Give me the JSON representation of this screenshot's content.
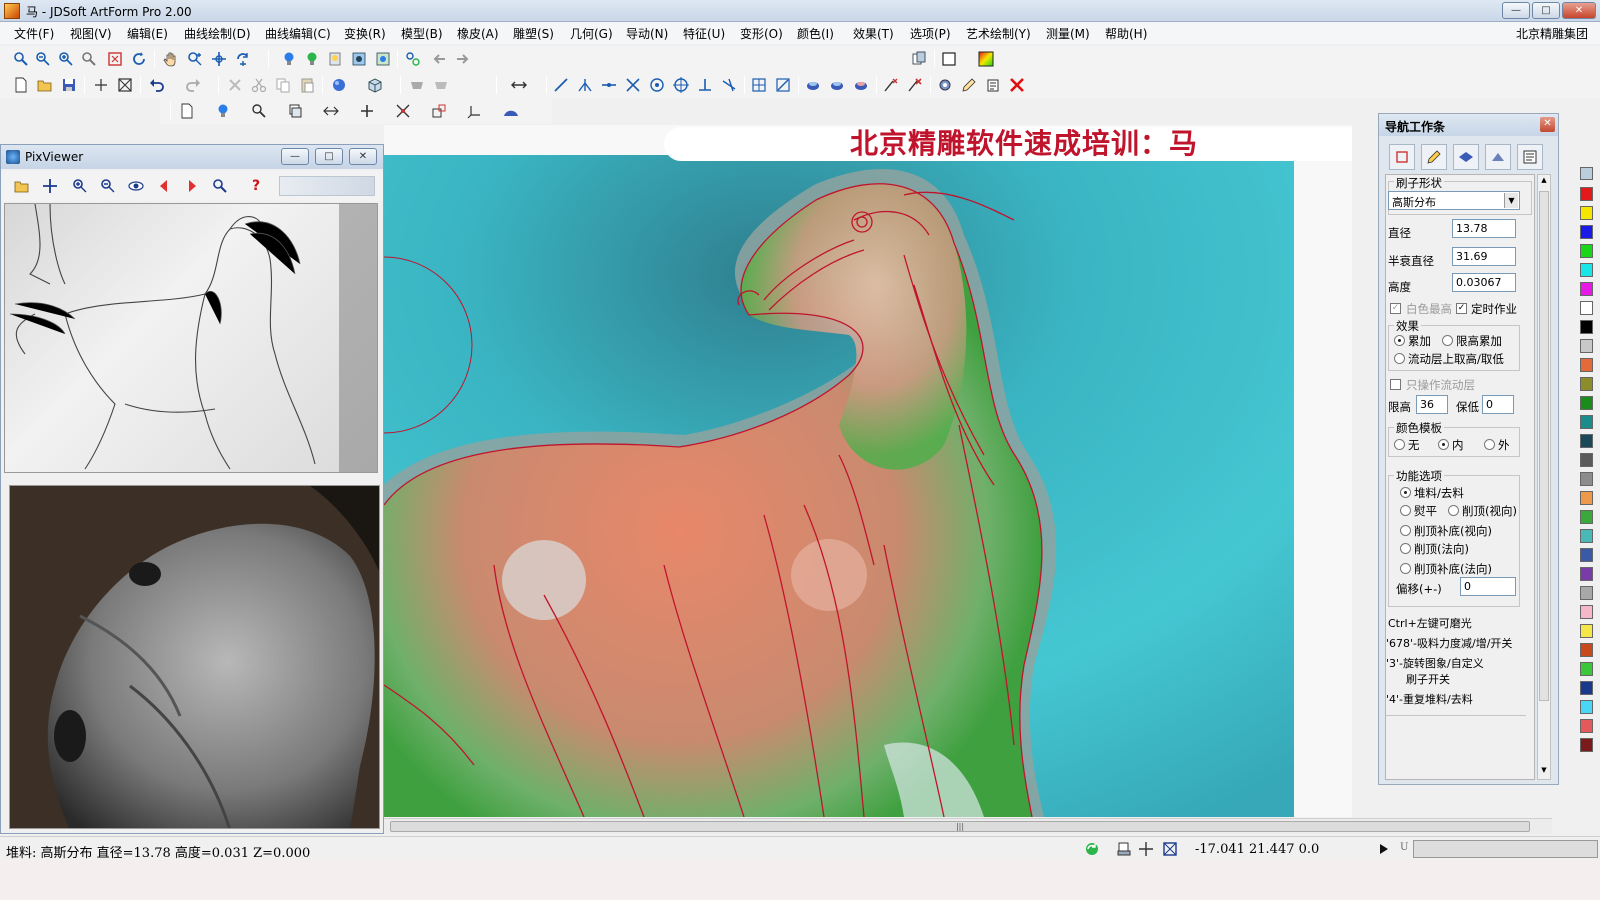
{
  "window": {
    "title": "马 - JDSoft ArtForm Pro 2.00",
    "min_label": "—",
    "max_label": "□",
    "close_label": "✕"
  },
  "menu": {
    "items": [
      "文件(F)",
      "视图(V)",
      "编辑(E)",
      "曲线绘制(D)",
      "曲线编辑(C)",
      "变换(R)",
      "模型(B)",
      "橡皮(A)",
      "雕塑(S)",
      "几何(G)",
      "导动(N)",
      "特征(U)",
      "变形(O)",
      "颜色(I)",
      "效果(T)",
      "选项(P)",
      "艺术绘制(Y)",
      "测量(M)",
      "帮助(H)"
    ],
    "company": "北京精雕集团"
  },
  "banner": {
    "text": "北京精雕软件速成培训：马"
  },
  "pixviewer": {
    "title": "PixViewer",
    "min_label": "—",
    "max_label": "□",
    "close_label": "✕",
    "help_label": "?"
  },
  "navpanel": {
    "title": "导航工作条",
    "close_label": "✕",
    "brush_shape_label": "刷子形状",
    "brush_shape_value": "高斯分布",
    "diameter_label": "直径",
    "diameter_value": "13.78",
    "half_decay_label": "半衰直径",
    "half_decay_value": "31.69",
    "height_label": "高度",
    "height_value": "0.03067",
    "white_highest_label": "白色最高",
    "timed_label": "定时作业",
    "effect_label": "效果",
    "accumulate_label": "累加",
    "limit_accumulate_label": "限高累加",
    "flow_layer_label": "流动层上取高/取低",
    "only_flow_layer_label": "只操作流动层",
    "limit_high_label": "限高",
    "limit_high_value": "36",
    "keep_low_label": "保低",
    "keep_low_value": "0",
    "color_template_label": "颜色模板",
    "color_none_label": "无",
    "color_inner_label": "内",
    "color_outer_label": "外",
    "function_label": "功能选项",
    "opt_pile": "堆料/去料",
    "opt_flatten": "熨平",
    "opt_shave_view": "削顶(视向)",
    "opt_shave_fill_view": "削顶补底(视向)",
    "opt_shave_normal": "削顶(法向)",
    "opt_shave_fill_normal": "削顶补底(法向)",
    "offset_label": "偏移(+-)",
    "offset_value": "0",
    "hint1": "Ctrl+左键可磨光",
    "hint2": "'678'-吸料力度减/增/开关",
    "hint3a": "'3'-旋转图象/自定义",
    "hint3b": "刷子开关",
    "hint4": "'4'-重复堆料/去料"
  },
  "palette": {
    "colors": [
      "#e41a1a",
      "#f5e600",
      "#1a1ae6",
      "#19d619",
      "#19e6e6",
      "#e619e6",
      "#ffffff",
      "#000000",
      "#c8c8c8",
      "#e46a3a",
      "#8c8c2a",
      "#1a8c1a",
      "#1a8c8c",
      "#1a4a5a",
      "#5a5a5a",
      "#8c8c8c",
      "#ee9a4a",
      "#3aa83a",
      "#4ab8b8",
      "#3a5aa8",
      "#7a3aa8",
      "#a8a8a8",
      "#f4b8c8",
      "#f5e64a",
      "#c84a1a",
      "#3ac83a",
      "#1a3a8c",
      "#4ad6f5",
      "#e45a5a",
      "#7a1a1a"
    ]
  },
  "status": {
    "left": "堆料: 高斯分布  直径=13.78  高度=0.031  Z=0.000",
    "coords": "-17.041  21.447  0.0",
    "u_label": "U"
  }
}
